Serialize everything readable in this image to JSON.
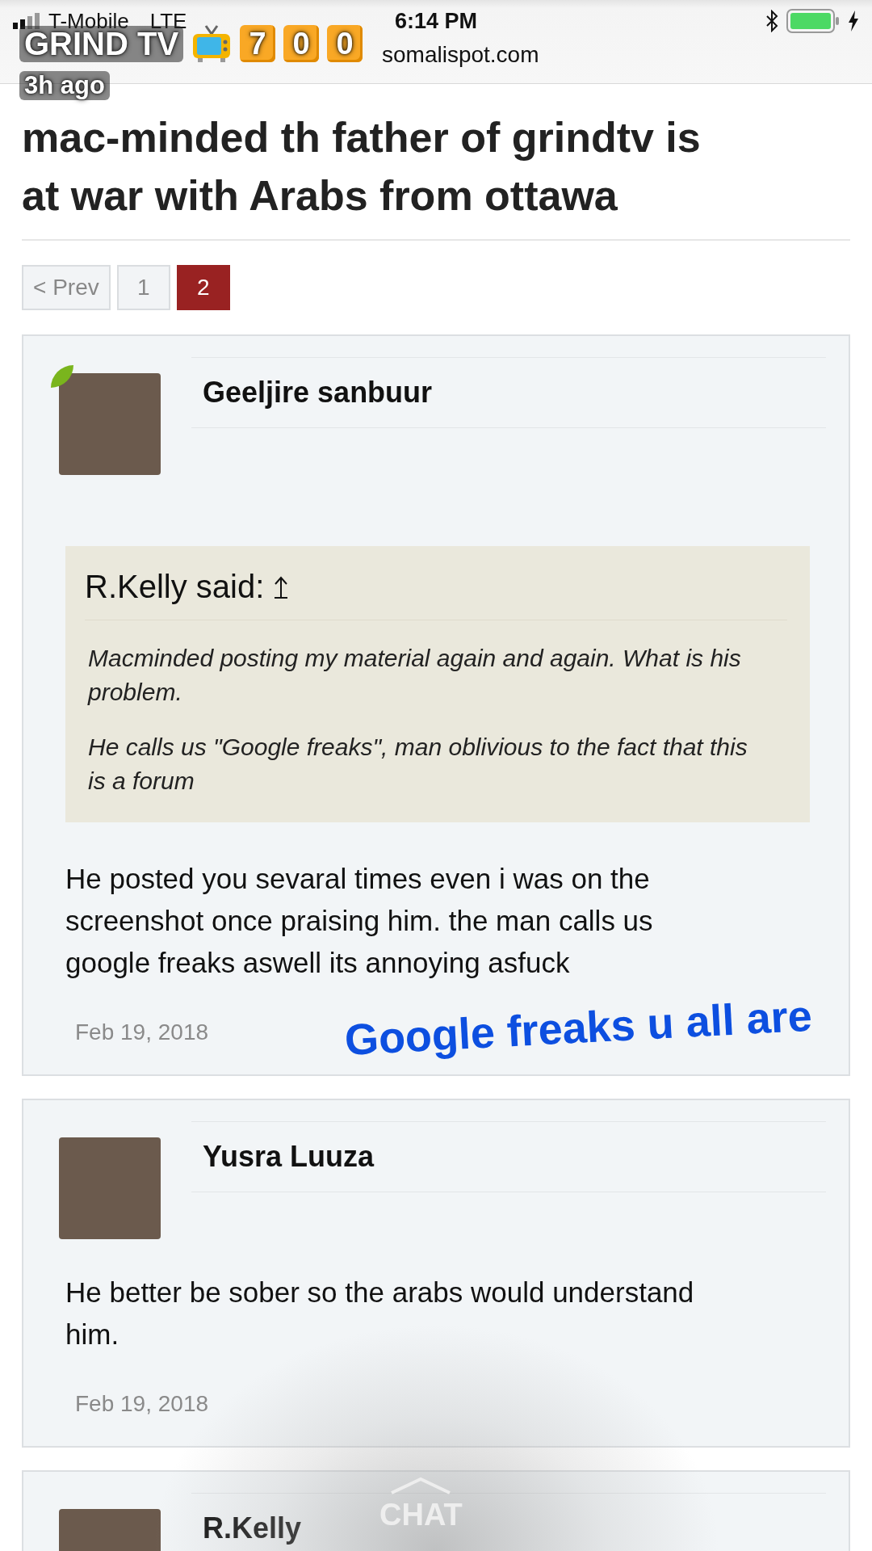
{
  "status_bar": {
    "carrier": "T-Mobile",
    "network": "LTE",
    "time": "6:14 PM",
    "url": "somalispot.com"
  },
  "story_overlay": {
    "title": "GRIND TV",
    "digits": [
      "7",
      "0",
      "0"
    ],
    "age": "3h ago"
  },
  "thread": {
    "title": "mac-minded th father of grindtv is at war with Arabs from ottawa",
    "pagination": [
      {
        "label": "< Prev",
        "selected": false
      },
      {
        "label": "1",
        "selected": false
      },
      {
        "label": "2",
        "selected": true
      }
    ],
    "posts": [
      {
        "author": "Geeljire sanbuur",
        "online": true,
        "quote": {
          "author": "R.Kelly said:",
          "paragraphs": [
            "Macminded posting my material again and again. What is his problem.",
            "He calls us \"Google freaks\", man oblivious to the fact that this is a forum"
          ]
        },
        "body": "He posted you sevaral times even i was on the screenshot once praising him. the man calls us google freaks aswell its annoying asfuck",
        "date": "Feb 19, 2018"
      },
      {
        "author": "Yusra Luuza",
        "online": false,
        "body": "He better be sober so the arabs would understand him.",
        "date": "Feb 19, 2018"
      },
      {
        "author": "R.Kelly",
        "online": false
      }
    ]
  },
  "caption": "Google freaks u all are",
  "chat_label": "CHAT"
}
